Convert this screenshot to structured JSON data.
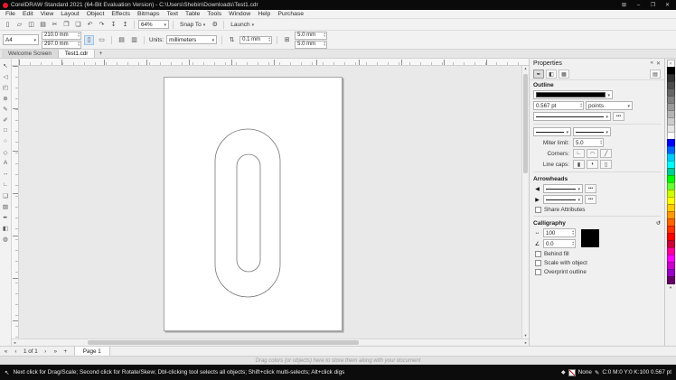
{
  "window": {
    "title": "CorelDRAW Standard 2021 (64-Bit Evaluation Version) - C:\\Users\\Shebin\\Downloads\\Test1.cdr",
    "minimize": "–",
    "maximize": "❐",
    "close": "✕"
  },
  "menubar": {
    "items": [
      "File",
      "Edit",
      "View",
      "Layout",
      "Object",
      "Effects",
      "Bitmaps",
      "Text",
      "Table",
      "Tools",
      "Window",
      "Help",
      "Purchase"
    ]
  },
  "toolbar": {
    "icons": [
      {
        "name": "new-document-icon",
        "glyph": "▯"
      },
      {
        "name": "open-icon",
        "glyph": "▱"
      },
      {
        "name": "save-icon",
        "glyph": "◫"
      },
      {
        "name": "print-icon",
        "glyph": "▤"
      },
      {
        "name": "cut-icon",
        "glyph": "✂"
      },
      {
        "name": "copy-icon",
        "glyph": "❐"
      },
      {
        "name": "paste-icon",
        "glyph": "❏"
      },
      {
        "name": "undo-icon",
        "glyph": "↶"
      },
      {
        "name": "redo-icon",
        "glyph": "↷"
      },
      {
        "name": "import-icon",
        "glyph": "↧"
      },
      {
        "name": "export-icon",
        "glyph": "↥"
      }
    ],
    "zoom_value": "64%",
    "snap_label": "Snap To",
    "launch_label": "Launch"
  },
  "property_bar": {
    "page_size": "A4",
    "page_width": "210.0 mm",
    "page_height": "297.0 mm",
    "units_label": "Units:",
    "units_value": "millimeters",
    "nudge_value": "0.1 mm",
    "duplicate_x": "5.0 mm",
    "duplicate_y": "5.0 mm"
  },
  "tabs": {
    "items": [
      {
        "label": "Welcome Screen"
      },
      {
        "label": "Test1.cdr"
      }
    ],
    "add": "+"
  },
  "toolbox": {
    "tools": [
      {
        "name": "pick-tool",
        "glyph": "↖"
      },
      {
        "name": "shape-tool",
        "glyph": "◁"
      },
      {
        "name": "crop-tool",
        "glyph": "◰"
      },
      {
        "name": "zoom-tool",
        "glyph": "⊕"
      },
      {
        "name": "freehand-tool",
        "glyph": "✎"
      },
      {
        "name": "artistic-media-tool",
        "glyph": "✐"
      },
      {
        "name": "rectangle-tool",
        "glyph": "□"
      },
      {
        "name": "ellipse-tool",
        "glyph": "○"
      },
      {
        "name": "polygon-tool",
        "glyph": "◇"
      },
      {
        "name": "text-tool",
        "glyph": "A"
      },
      {
        "name": "dimension-tool",
        "glyph": "↔"
      },
      {
        "name": "connector-tool",
        "glyph": "∟"
      },
      {
        "name": "drop-shadow-tool",
        "glyph": "❏"
      },
      {
        "name": "transparency-tool",
        "glyph": "▨"
      },
      {
        "name": "eyedropper-tool",
        "glyph": "✒"
      },
      {
        "name": "interactive-fill-tool",
        "glyph": "◧"
      },
      {
        "name": "smart-fill-tool",
        "glyph": "◍"
      }
    ]
  },
  "properties_panel": {
    "title": "Properties",
    "outline_section": "Outline",
    "width_value": "0.567 pt",
    "width_units": "points",
    "miter_label": "Miter limit:",
    "miter_value": "5.0",
    "corners_label": "Corners:",
    "corner_options": [
      "∟",
      "◠",
      "╱"
    ],
    "line_caps_label": "Line caps:",
    "cap_options": [
      "▮",
      "◗",
      "▯"
    ],
    "arrowheads_label": "Arrowheads",
    "share_attributes_label": "Share Attributes",
    "calligraphy_label": "Calligraphy",
    "stretch_value": "100",
    "angle_value": "0.0",
    "behind_fill_label": "Behind fill",
    "scale_with_object_label": "Scale with object",
    "overprint_label": "Overprint outline"
  },
  "palette": {
    "colors": [
      "#000000",
      "#333333",
      "#4d4d4d",
      "#666666",
      "#808080",
      "#999999",
      "#b3b3b3",
      "#cccccc",
      "#e6e6e6",
      "#ffffff",
      "#0000ff",
      "#0066ff",
      "#00ccff",
      "#00ffff",
      "#00cc99",
      "#00ff00",
      "#66ff33",
      "#ccff00",
      "#ffff00",
      "#ffcc00",
      "#ff9900",
      "#ff6600",
      "#ff3300",
      "#ff0000",
      "#cc0033",
      "#ff0099",
      "#ff00ff",
      "#cc00cc",
      "#9900cc",
      "#660066"
    ]
  },
  "navigation": {
    "first": "«",
    "prev": "‹",
    "counter": "1 of 1",
    "next": "›",
    "last": "»",
    "add_page": "+",
    "page_tab": "Page 1"
  },
  "document_palette_hint": "Drag colors (or objects) here to store them along with your document",
  "status_bar": {
    "hint": "Next click for Drag/Scale; Second click for Rotate/Skew; Dbl-clicking tool selects all objects; Shift+click multi-selects; Alt+click digs",
    "fill_label": "None",
    "outline_value": "C:0 M:0 Y:0 K:100  0.567 pt"
  },
  "glyphs": {
    "grid": "⊞",
    "gear": "⚙",
    "dock": "«",
    "close": "✕",
    "pen": "✒",
    "fill": "◧",
    "transparency": "▦",
    "page": "▤",
    "ellipsis": "•••",
    "arrow_start": "◀",
    "arrow_end": "▶",
    "stretch": "↔",
    "angle": "∠",
    "reset": "↺",
    "nudge": "⇅",
    "duplicate": "⊞",
    "portrait": "▯",
    "landscape": "▭",
    "all_pages": "▤",
    "current_page": "▥",
    "up": "▴",
    "down": "▾",
    "left": "◂",
    "right": "▸",
    "no_color": "✕",
    "cursor": "↖",
    "pen_status": "✎",
    "fill_diamond": "◆"
  },
  "colors": {
    "accent_red": "#e8192c",
    "titlebar": "#0a0a0a",
    "statusbar": "#0c0c0c",
    "canvas": "#e9e9e9",
    "outline_color": "#000000"
  }
}
